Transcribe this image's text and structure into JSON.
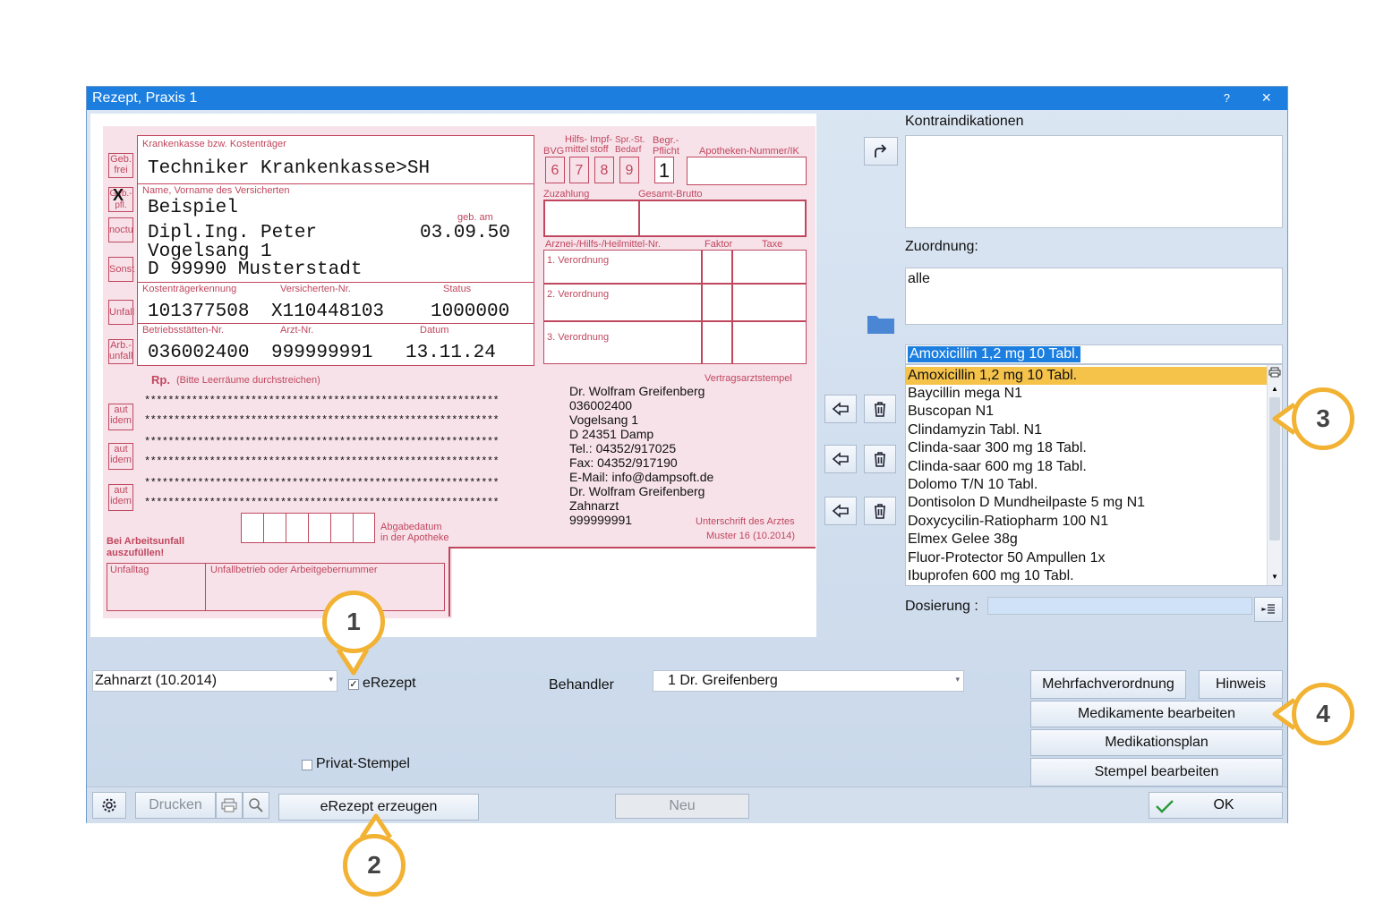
{
  "window": {
    "title": "Rezept, Praxis 1",
    "help": "?",
    "close": "×"
  },
  "form": {
    "kasse_label": "Krankenkasse bzw. Kostenträger",
    "kasse": "Techniker Krankenkasse>SH",
    "side_labels": [
      "Geb.\nfrei",
      "Geb.-\npfl.",
      "noctu",
      "Sonst",
      "Unfall",
      "Arb.-\nunfall"
    ],
    "gebpfl_mark": "X",
    "name_label": "Name, Vorname des Versicherten",
    "name_line1": "Beispiel",
    "name_line2": "Dipl.Ing. Peter",
    "name_line3": "Vogelsang 1",
    "name_line4": "D 99990 Musterstadt",
    "geb_label": "geb. am",
    "geb": "03.09.50",
    "ktk_label": "Kostenträgerkennung",
    "vnr_label": "Versicherten-Nr.",
    "status_label": "Status",
    "ktk": "101377508",
    "vnr": "X110448103",
    "status": "1000000",
    "bsnr_label": "Betriebsstätten-Nr.",
    "arzt_label": "Arzt-Nr.",
    "datum_label": "Datum",
    "bsnr": "036002400",
    "arzt": "999999991",
    "datum": "13.11.24",
    "bvg": "BVG",
    "hilfs": "Hilfs-\nmittel",
    "impf": "Impf-\nstoff",
    "spr": "Spr.-St.\nBedarf",
    "begr": "Begr.-\nPflicht",
    "apo_label": "Apotheken-Nummer/IK",
    "digits": [
      "6",
      "7",
      "8",
      "9"
    ],
    "begr_digit": "1",
    "zuzahlung": "Zuzahlung",
    "gesamt": "Gesamt-Brutto",
    "arznei_label": "Arznei-/Hilfs-/Heilmittel-Nr.",
    "faktor": "Faktor",
    "taxe": "Taxe",
    "verordnungen": [
      "1. Verordnung",
      "2. Verordnung",
      "3. Verordnung"
    ],
    "rp": "Rp.",
    "rp_hint": "(Bitte Leerräume durchstreichen)",
    "stars": "************************************************************",
    "aut_idem": "aut\nidem",
    "vertragsarzt": "Vertragsarztstempel",
    "stempel": [
      "Dr. Wolfram Greifenberg",
      "036002400",
      "Vogelsang 1",
      "D 24351 Damp",
      "Tel.: 04352/917025",
      "Fax: 04352/917190",
      "E-Mail: info@dampsoft.de",
      "Dr. Wolfram Greifenberg",
      "Zahnarzt",
      "999999991"
    ],
    "abgabe": "Abgabedatum\nin der Apotheke",
    "unterschrift": "Unterschrift des Arztes",
    "muster": "Muster 16 (10.2014)",
    "arbeitsunfall": "Bei Arbeitsunfall\nauszufüllen!",
    "unfalltag": "Unfalltag",
    "unfallbetrieb": "Unfallbetrieb oder Arbeitgebernummer"
  },
  "right": {
    "kontra_label": "Kontraindikationen",
    "kontra_value": "",
    "zuordnung_label": "Zuordnung:",
    "zuordnung_value": "alle",
    "med_search": "Amoxicillin 1,2 mg 10 Tabl.",
    "med_list": [
      "Amoxicillin 1,2 mg 10 Tabl.",
      "Baycillin mega N1",
      "Buscopan N1",
      "Clindamyzin Tabl. N1",
      "Clinda-saar 300 mg 18 Tabl.",
      "Clinda-saar 600 mg 18 Tabl.",
      "Dolomo T/N 10 Tabl.",
      "Dontisolon D Mundheilpaste 5 mg N1",
      "Doxycycilin-Ratiopharm 100 N1",
      "Elmex Gelee 38g",
      "Fluor-Protector 50 Ampullen 1x",
      "Ibuprofen 600 mg 10 Tabl."
    ],
    "dosierung_label": "Dosierung :",
    "dosierung_value": ""
  },
  "bottom": {
    "formular": "Zahnarzt (10.2014)",
    "erezept_label": "eRezept",
    "erezept_checked": "✓",
    "behandler_label": "Behandler",
    "behandler": "1 Dr. Greifenberg",
    "privat_label": "Privat-Stempel",
    "mehrfach": "Mehrfachverordnung",
    "hinweis": "Hinweis",
    "med_bearbeiten": "Medikamente bearbeiten",
    "medplan": "Medikationsplan",
    "stempel_bearbeiten": "Stempel bearbeiten",
    "drucken": "Drucken",
    "erezept_erzeugen": "eRezept erzeugen",
    "neu": "Neu",
    "ok": "OK"
  },
  "callouts": [
    "1",
    "2",
    "3",
    "4"
  ],
  "colors": {
    "title_bar": "#1c7fe0",
    "form_red": "#c0475e",
    "form_pink": "#f7e2ea",
    "selection": "#1c7fe0",
    "highlight": "#f5c24a",
    "callout": "#f2b233"
  }
}
